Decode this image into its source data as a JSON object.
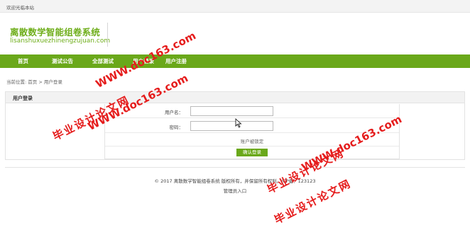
{
  "topbar": {
    "welcome": "欢迎光临本站"
  },
  "header": {
    "site_title": "离散数学智能组卷系统",
    "site_domain": "lisanshuxuezhinengzujuan.com"
  },
  "nav": {
    "items": [
      {
        "label": "首页"
      },
      {
        "label": "测试公告"
      },
      {
        "label": "全部测试"
      },
      {
        "label": "用户登录"
      },
      {
        "label": "用户注册"
      }
    ]
  },
  "breadcrumb": {
    "text": "当前位置: 首页 > 用户登录"
  },
  "login": {
    "panel_title": "用户登录",
    "username_label": "用户名：",
    "username_value": "",
    "password_label": "密码：",
    "password_value": "",
    "lock_text": "账户被锁定",
    "submit_label": "确认登录"
  },
  "footer": {
    "copyright": "© 2017 离散数学智能组卷系统 版权所有，并保留所有权利。ICP备：123123",
    "admin_link": "管理员入口"
  },
  "watermarks": [
    {
      "text": "WWW.doc163.com"
    },
    {
      "text": "毕业设计论文网"
    },
    {
      "text": "WWW.doc163.com"
    },
    {
      "text": "毕业设计论文网"
    },
    {
      "text": "WWW.doc163.com"
    },
    {
      "text": "毕业设计论文网"
    }
  ],
  "colors": {
    "brand_green": "#6aa81a",
    "watermark_red": "#e51c1c"
  }
}
